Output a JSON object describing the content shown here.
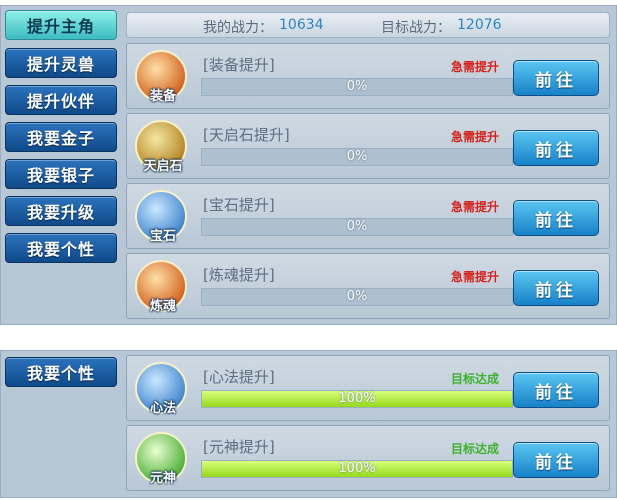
{
  "sidebar_top": [
    {
      "label": "提升主角",
      "active": true
    },
    {
      "label": "提升灵兽",
      "active": false
    },
    {
      "label": "提升伙伴",
      "active": false
    },
    {
      "label": "我要金子",
      "active": false
    },
    {
      "label": "我要银子",
      "active": false
    },
    {
      "label": "我要升级",
      "active": false
    },
    {
      "label": "我要个性",
      "active": false
    }
  ],
  "sidebar_bottom": [
    {
      "label": "我要个性",
      "active": false
    }
  ],
  "power": {
    "my_label": "我的战力：",
    "my_value": "10634",
    "target_label": "目标战力：",
    "target_value": "12076"
  },
  "rows_top": [
    {
      "title": "[装备提升]",
      "icon": "equipment-icon",
      "caption": "装备",
      "status": "急需提升",
      "progress": "0%",
      "button": "前往"
    },
    {
      "title": "[天启石提升]",
      "icon": "tianqi-stone-icon",
      "caption": "天启石",
      "status": "急需提升",
      "progress": "0%",
      "button": "前往"
    },
    {
      "title": "[宝石提升]",
      "icon": "gem-icon",
      "caption": "宝石",
      "status": "急需提升",
      "progress": "0%",
      "button": "前往"
    },
    {
      "title": "[炼魂提升]",
      "icon": "soul-refine-icon",
      "caption": "炼魂",
      "status": "急需提升",
      "progress": "0%",
      "button": "前往"
    }
  ],
  "rows_bottom": [
    {
      "title": "[心法提升]",
      "icon": "mind-method-icon",
      "caption": "心法",
      "status": "目标达成",
      "progress": "100%",
      "button": "前往"
    },
    {
      "title": "[元神提升]",
      "icon": "primal-spirit-icon",
      "caption": "元神",
      "status": "目标达成",
      "progress": "100%",
      "button": "前往"
    }
  ],
  "colors": {
    "urgent": "#d6221a",
    "done": "#3eb22e",
    "button": "#1781c8",
    "active_tab": "#3bbcc0"
  }
}
